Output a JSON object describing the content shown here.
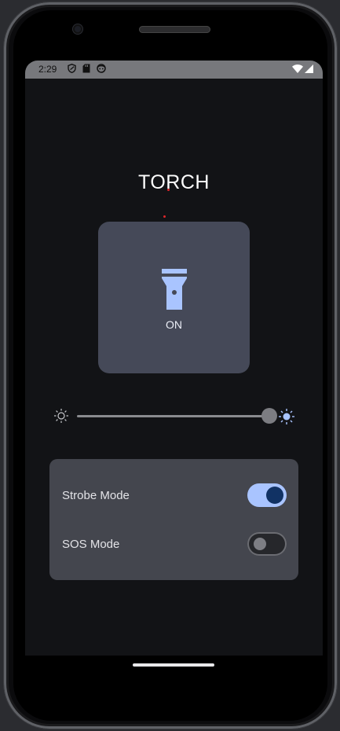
{
  "status_bar": {
    "time": "2:29",
    "left_icons": [
      "shield-icon",
      "sd-card-icon",
      "face-icon"
    ],
    "right_icons": [
      "wifi-icon",
      "signal-icon"
    ]
  },
  "app": {
    "title": "TORCH",
    "torch_button": {
      "state_label": "ON",
      "icon": "flashlight-icon"
    },
    "brightness_slider": {
      "min_icon": "brightness-low-icon",
      "max_icon": "brightness-high-icon",
      "value": 1.0
    },
    "settings": [
      {
        "label": "Strobe Mode",
        "enabled": true
      },
      {
        "label": "SOS Mode",
        "enabled": false
      }
    ]
  },
  "colors": {
    "background": "#121316",
    "card": "#454958",
    "accent": "#a9c4ff",
    "accent_dark": "#113264"
  }
}
